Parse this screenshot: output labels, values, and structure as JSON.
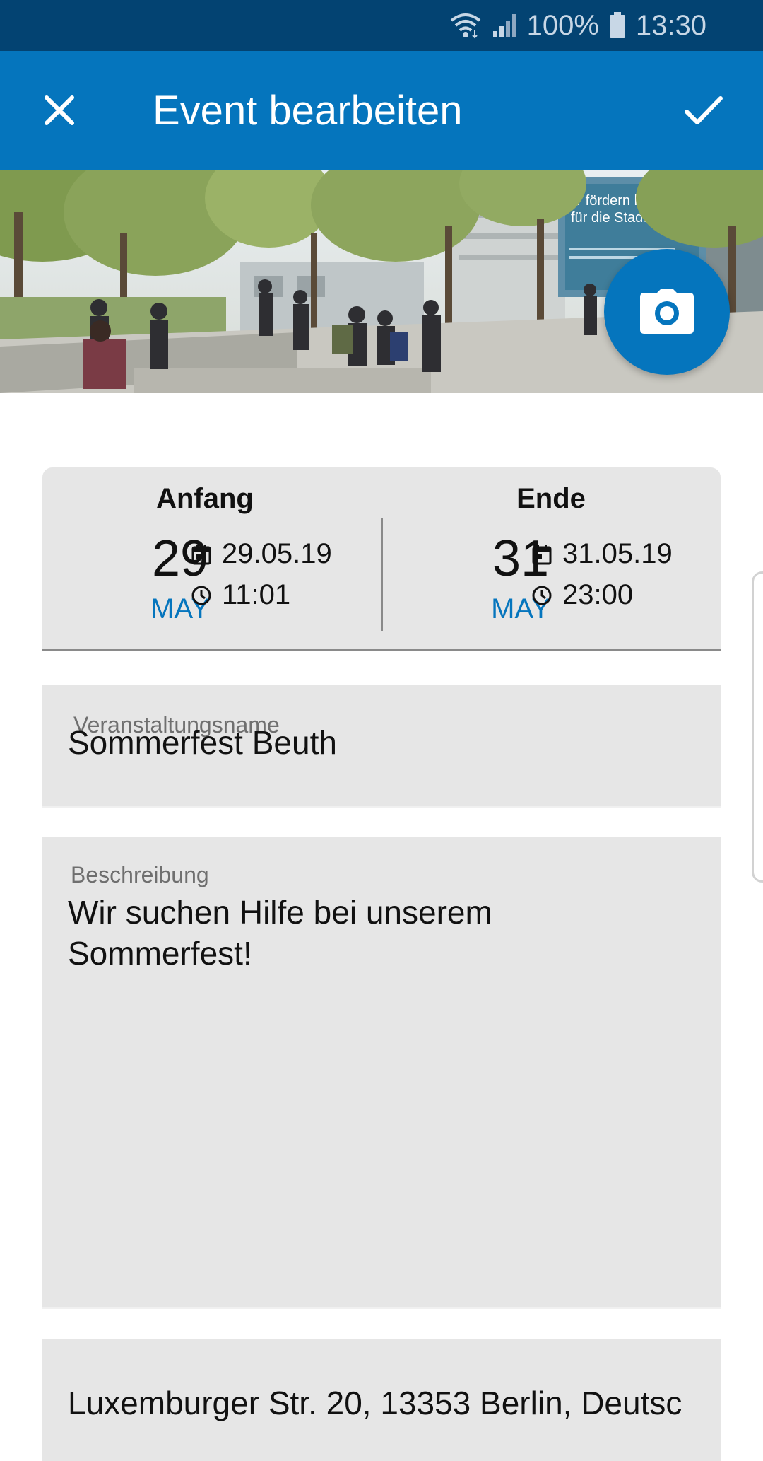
{
  "status_bar": {
    "battery_percent": "100%",
    "time": "13:30",
    "icons": [
      "wifi-icon",
      "signal-icon",
      "battery-icon"
    ]
  },
  "app_bar": {
    "title": "Event bearbeiten",
    "close_icon": "close-icon",
    "confirm_icon": "checkmark-icon"
  },
  "header_image": {
    "camera_icon": "camera-icon",
    "banner_text_line1": "ir fördern k",
    "banner_text_line2": "für die Stadt"
  },
  "dates": {
    "start": {
      "label": "Anfang",
      "day": "29",
      "month": "MAY",
      "date": "29.05.19",
      "time": "11:01"
    },
    "end": {
      "label": "Ende",
      "day": "31",
      "month": "MAY",
      "date": "31.05.19",
      "time": "23:00"
    }
  },
  "fields": {
    "name": {
      "label": "Veranstaltungsname",
      "value": "Sommerfest Beuth"
    },
    "description": {
      "label": "Beschreibung",
      "value": "Wir suchen Hilfe bei unserem\nSommerfest!"
    },
    "address": {
      "value": "Luxemburger Str. 20, 13353 Berlin, Deutsc"
    }
  },
  "colors": {
    "status_bar": "#034372",
    "app_bar": "#0575bd",
    "accent": "#0575bd",
    "field_background": "#e6e6e6"
  }
}
